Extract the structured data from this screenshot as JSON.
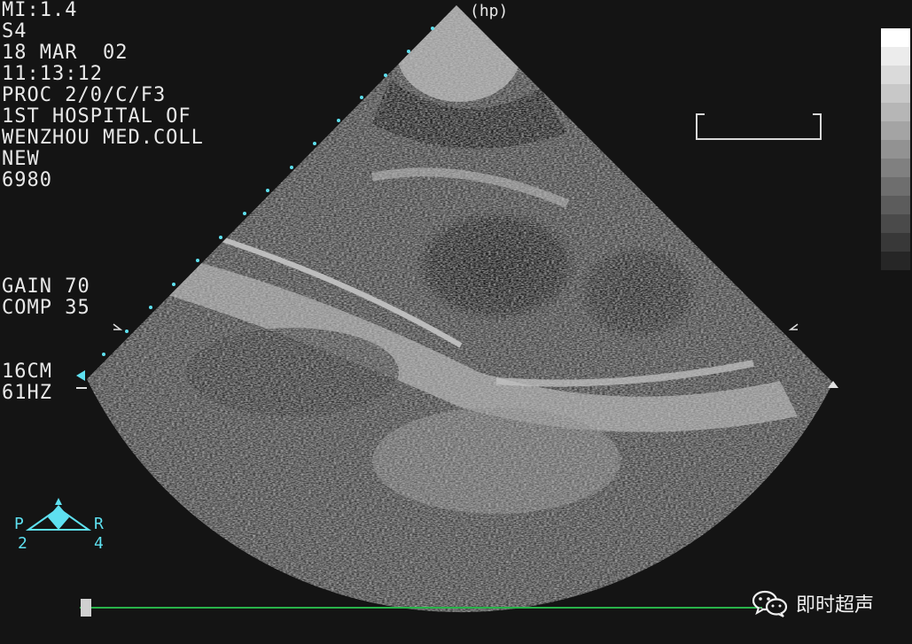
{
  "header": {
    "mi": "MI:1.4",
    "probe": "S4",
    "date": "18 MAR  02",
    "time": "11:13:12",
    "proc": "PROC 2/0/C/F3",
    "hospital_line1": "1ST HOSPITAL OF",
    "hospital_line2": "WENZHOU MED.COLL",
    "patient": "NEW",
    "id": "6980"
  },
  "settings": {
    "gain": "GAIN 70",
    "comp": "COMP 35"
  },
  "depth": {
    "depth": "16CM",
    "frame_rate": "61HZ"
  },
  "hp_label": "hp",
  "orientation": {
    "left_letter": "P",
    "right_letter": "R",
    "left_number": "2",
    "right_number": "4"
  },
  "watermark": {
    "text": "即时超声",
    "icon": "wechat-icon"
  },
  "colors": {
    "text": "#e8e8e8",
    "accent_cyan": "#5ee0f0",
    "timeline_green": "#29b34a"
  }
}
